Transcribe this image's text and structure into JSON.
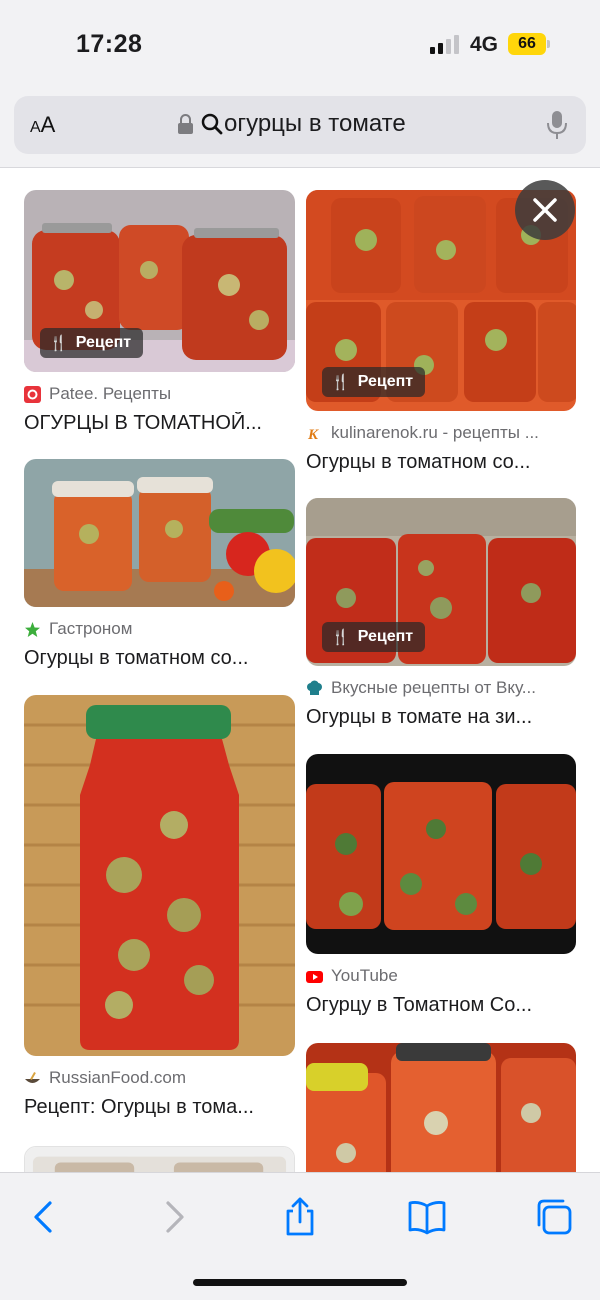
{
  "status_bar": {
    "time": "17:28",
    "network": "4G",
    "battery": "66"
  },
  "address_bar": {
    "text_size_label": "AA",
    "query": "огурцы в томате"
  },
  "results": [
    {
      "source": "Patee. Рецепты",
      "title": "ОГУРЦЫ В ТОМАТНОЙ...",
      "badge": "Рецепт",
      "favicon": "patee-icon"
    },
    {
      "source": "kulinarenok.ru - рецепты ...",
      "title": "Огурцы в томатном со...",
      "badge": "Рецепт",
      "favicon": "kulinarenok-icon"
    },
    {
      "source": "Гастроном",
      "title": "Огурцы в томатном со...",
      "badge": "",
      "favicon": "gastronom-star-icon"
    },
    {
      "source": "Вкусные рецепты от Вку...",
      "title": "Огурцы в томате на зи...",
      "badge": "Рецепт",
      "favicon": "chef-hat-icon"
    },
    {
      "source": "RussianFood.com",
      "title": "Рецепт: Огурцы в тома...",
      "badge": "",
      "favicon": "russianfood-icon"
    },
    {
      "source": "YouTube",
      "title": "Огурцу в Томатном Со...",
      "badge": "",
      "favicon": "youtube-icon"
    }
  ],
  "colors": {
    "accent": "#007aff",
    "battery": "#ffd60a",
    "youtube": "#ff0000"
  },
  "toolbar": [
    "back-icon",
    "forward-icon",
    "share-icon",
    "bookmarks-icon",
    "tabs-icon"
  ]
}
